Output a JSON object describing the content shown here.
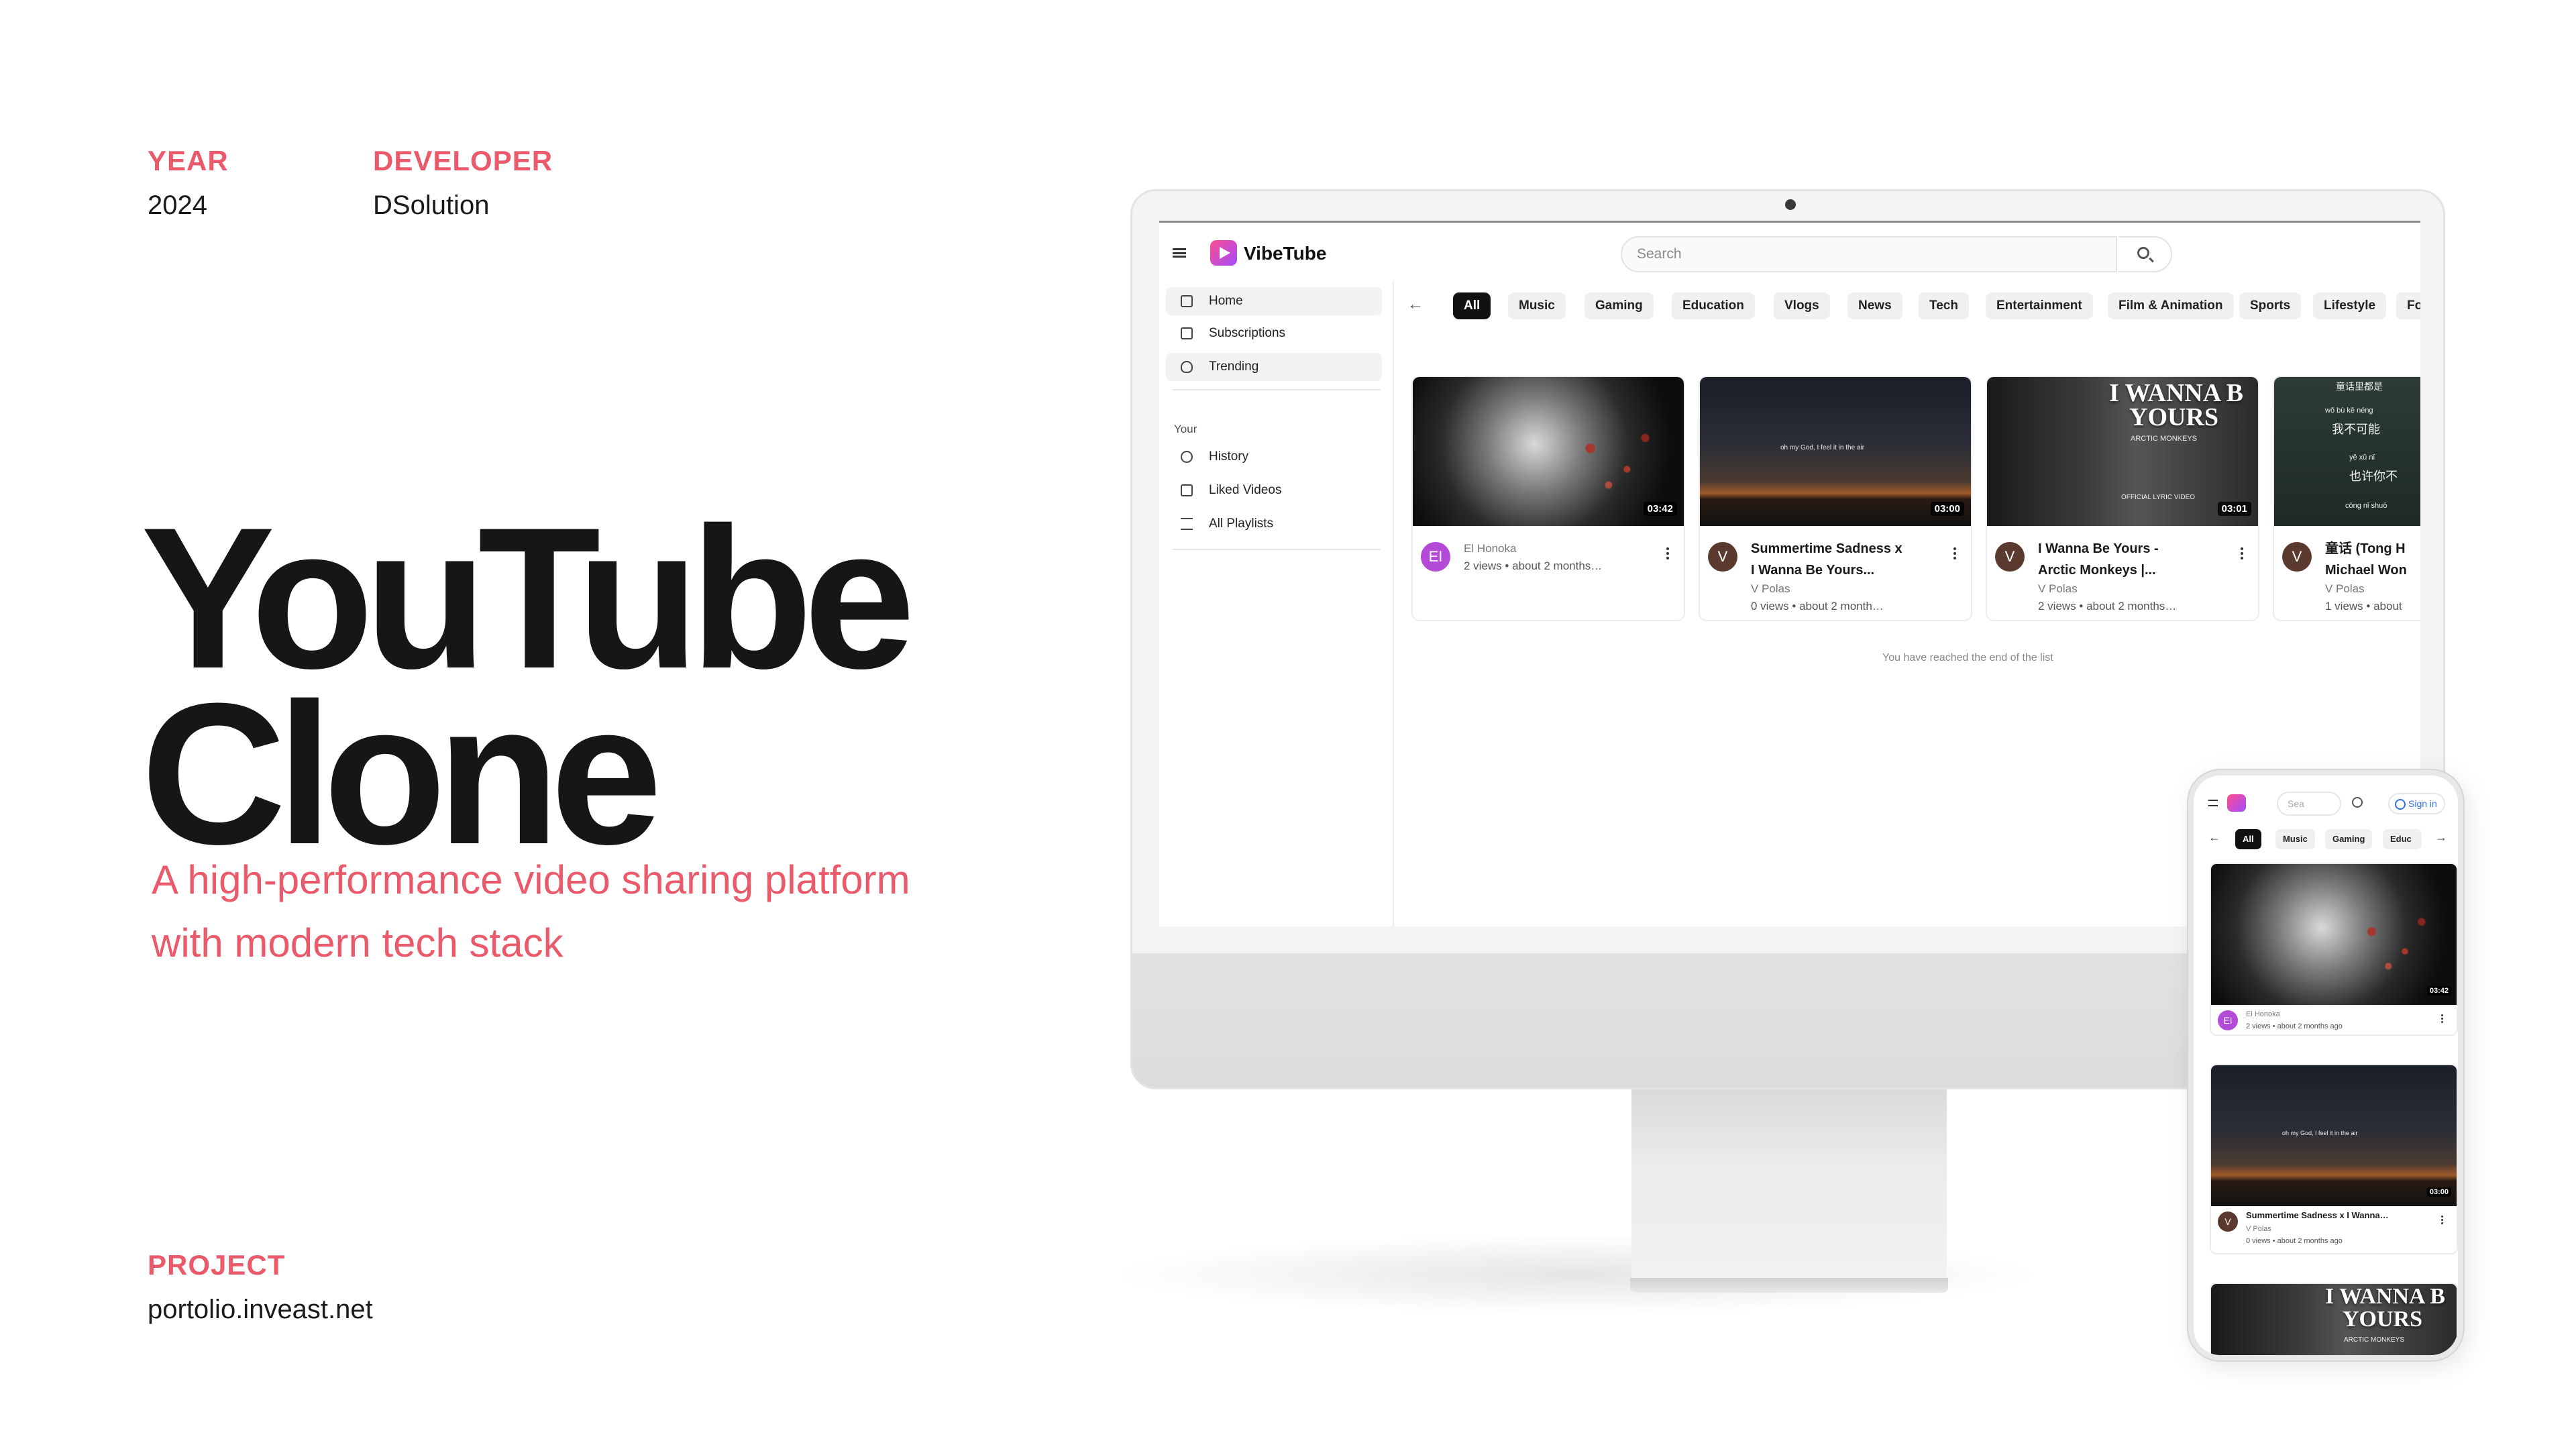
{
  "meta": {
    "year_label": "YEAR",
    "year_value": "2024",
    "developer_label": "DEVELOPER",
    "developer_value": "DSolution",
    "project_label": "PROJECT",
    "project_value": "portolio.inveast.net"
  },
  "hero": {
    "title_line1": "YouTube",
    "title_line2": "Clone",
    "subtitle_line1": "A high-performance video sharing platform",
    "subtitle_line2": "with modern tech stack"
  },
  "colors": {
    "accent": "#ea5a6b",
    "brand_gradient_start": "#ff4d8d",
    "brand_gradient_end": "#a24bff",
    "active_chip": "#111111"
  },
  "app": {
    "name": "VibeTube",
    "search_placeholder": "Search",
    "sidebar": {
      "main_items": [
        {
          "label": "Home",
          "icon": "home-icon"
        },
        {
          "label": "Subscriptions",
          "icon": "subscriptions-icon"
        },
        {
          "label": "Trending",
          "icon": "flame-icon"
        }
      ],
      "section_label": "Your",
      "your_items": [
        {
          "label": "History",
          "icon": "history-icon"
        },
        {
          "label": "Liked Videos",
          "icon": "thumbs-up-icon"
        },
        {
          "label": "All Playlists",
          "icon": "playlist-icon"
        }
      ]
    },
    "chips": [
      "All",
      "Music",
      "Gaming",
      "Education",
      "Vlogs",
      "News",
      "Tech",
      "Entertainment",
      "Film & Animation",
      "Sports",
      "Lifestyle",
      "Foo"
    ],
    "active_chip": "All",
    "videos": [
      {
        "title": "",
        "channel": "El Honoka",
        "stats": "2 views • about 2 months…",
        "duration": "03:42",
        "avatar": "EI",
        "avatar_color": "#b34ad8"
      },
      {
        "title_line1": "Summertime Sadness x",
        "title_line2": "I Wanna Be Yours...",
        "channel": "V Polas",
        "stats": "0 views • about 2 month…",
        "duration": "03:00",
        "avatar": "V",
        "avatar_color": "#5a3a2e",
        "thumb_text": "oh my God, I feel it in the air"
      },
      {
        "title_line1": "I Wanna Be Yours -",
        "title_line2": "Arctic Monkeys |...",
        "channel": "V Polas",
        "stats": "2 views • about 2 months…",
        "duration": "03:01",
        "avatar": "V",
        "avatar_color": "#5a3a2e",
        "thumb_line1": "I WANNA B",
        "thumb_line2": "YOURS",
        "thumb_line3": "ARCTIC MONKEYS",
        "thumb_line4": "OFFICIAL LYRIC VIDEO"
      },
      {
        "title_line1": "童话 (Tong H",
        "title_line2": "Michael Won",
        "channel": "V Polas",
        "stats": "1 views • about",
        "duration": "",
        "avatar": "V",
        "avatar_color": "#5a3a2e",
        "thumb_line1": "童话里都是",
        "thumb_line2": "wǒ bù kě néng",
        "thumb_line3": "我不可能",
        "thumb_line4": "yě xǔ nǐ",
        "thumb_line5": "也许你不",
        "thumb_line6": "cōng nǐ shuō"
      }
    ],
    "end_note": "You have reached the end of the list"
  },
  "mobile": {
    "search_placeholder": "Sea",
    "signin_label": "Sign in",
    "chips": [
      "All",
      "Music",
      "Gaming",
      "Educ"
    ],
    "videos": [
      {
        "title": "",
        "channel": "El Honoka",
        "stats": "2 views • about 2 months ago",
        "duration": "03:42",
        "avatar": "EI"
      },
      {
        "title": "Summertime Sadness x I Wanna…",
        "channel": "V Polas",
        "stats": "0 views • about 2 months ago",
        "duration": "03:00",
        "avatar": "V",
        "thumb_text": "oh my God, I feel it in the air"
      },
      {
        "thumb_line1": "I WANNA B",
        "thumb_line2": "YOURS",
        "thumb_line3": "ARCTIC MONKEYS"
      }
    ]
  }
}
